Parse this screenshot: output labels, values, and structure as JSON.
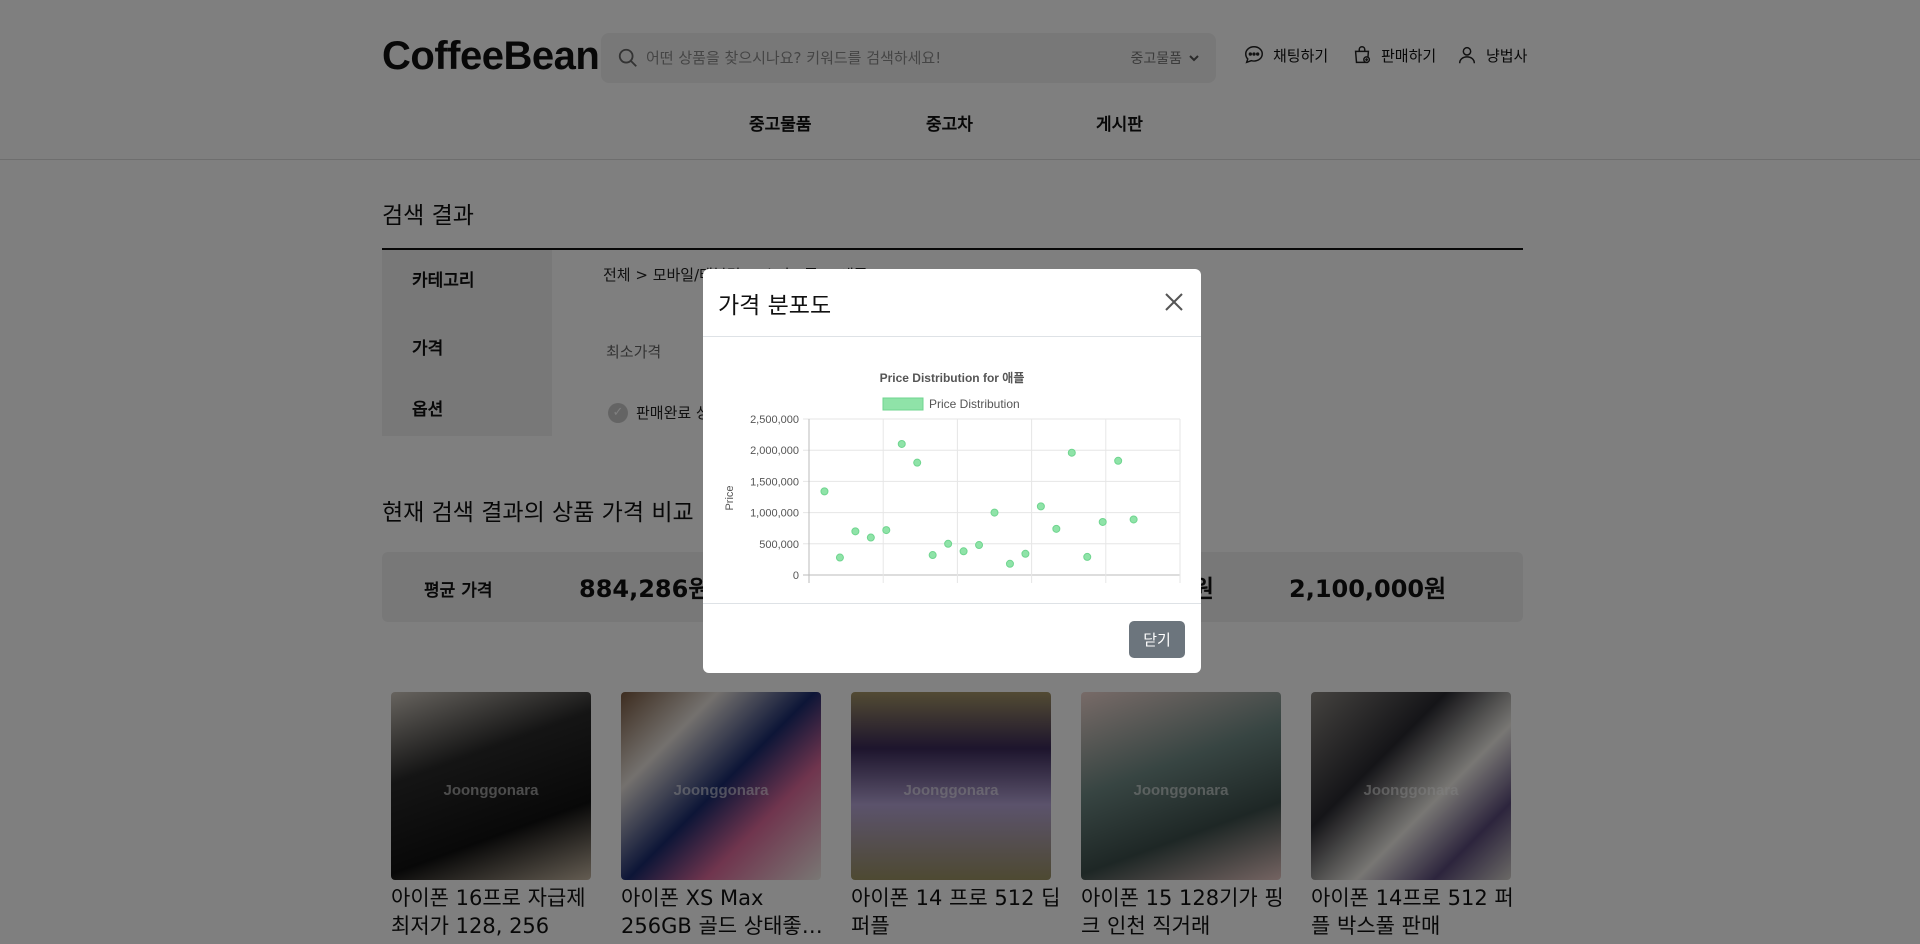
{
  "header": {
    "logo": "CoffeeBean",
    "search_placeholder": "어떤 상품을 찾으시나요? 키워드를 검색하세요!",
    "search_category": "중고물품",
    "chat_label": "채팅하기",
    "sell_label": "판매하기",
    "user_label": "냥법사",
    "menu": [
      "중고물품",
      "중고차",
      "게시판"
    ]
  },
  "main": {
    "result_title": "검색 결과",
    "filter_labels": [
      "카테고리",
      "가격",
      "옵션"
    ],
    "breadcrumb": "전체 > 모바일/태블릿 > 스마트폰 > 애플",
    "min_price_label": "최소가격",
    "sold_label": "판매완료 상품 포함",
    "compare_title": "현재 검색 결과의 상품 가격 비교",
    "avg_label": "평균 가격",
    "avg_value": "884,286원",
    "max_value": "2,100,000원",
    "max_fragment": "원"
  },
  "products": [
    {
      "name": "아이폰 16프로 자급제 최저가 128, 256",
      "watermark": "Joonggonara"
    },
    {
      "name": "아이폰 XS Max 256GB 골드 상태좋…",
      "watermark": "Joonggonara"
    },
    {
      "name": "아이폰 14 프로 512 딥퍼플",
      "watermark": "Joonggonara"
    },
    {
      "name": "아이폰 15 128기가 핑크 인천 직거래",
      "watermark": "Joonggonara"
    },
    {
      "name": "아이폰 14프로 512 퍼플 박스풀 판매",
      "watermark": "Joonggonara"
    }
  ],
  "modal": {
    "title": "가격 분포도",
    "close_button": "닫기"
  },
  "chart_data": {
    "type": "scatter",
    "title": "Price Distribution for 애플",
    "legend": "Price Distribution",
    "legend_position": "top",
    "ylabel": "Price",
    "xlabel": "",
    "ylim": [
      0,
      2500000
    ],
    "yticks": [
      "2,500,000",
      "2,000,000",
      "1,500,000",
      "1,000,000",
      "500,000",
      "0"
    ],
    "grid": true,
    "color": "#8fe3a8",
    "x": [
      1,
      2,
      3,
      4,
      5,
      6,
      7,
      8,
      9,
      10,
      11,
      12,
      13,
      14,
      15,
      16,
      17,
      18,
      19,
      20,
      21
    ],
    "y": [
      1340000,
      280000,
      700000,
      600000,
      720000,
      2100000,
      1800000,
      320000,
      500000,
      380000,
      480000,
      1000000,
      180000,
      340000,
      1100000,
      740000,
      1960000,
      290000,
      850000,
      1830000,
      890000
    ]
  },
  "colors": {
    "accent_green": "#8fe3a8",
    "button_gray": "#6c757d"
  }
}
